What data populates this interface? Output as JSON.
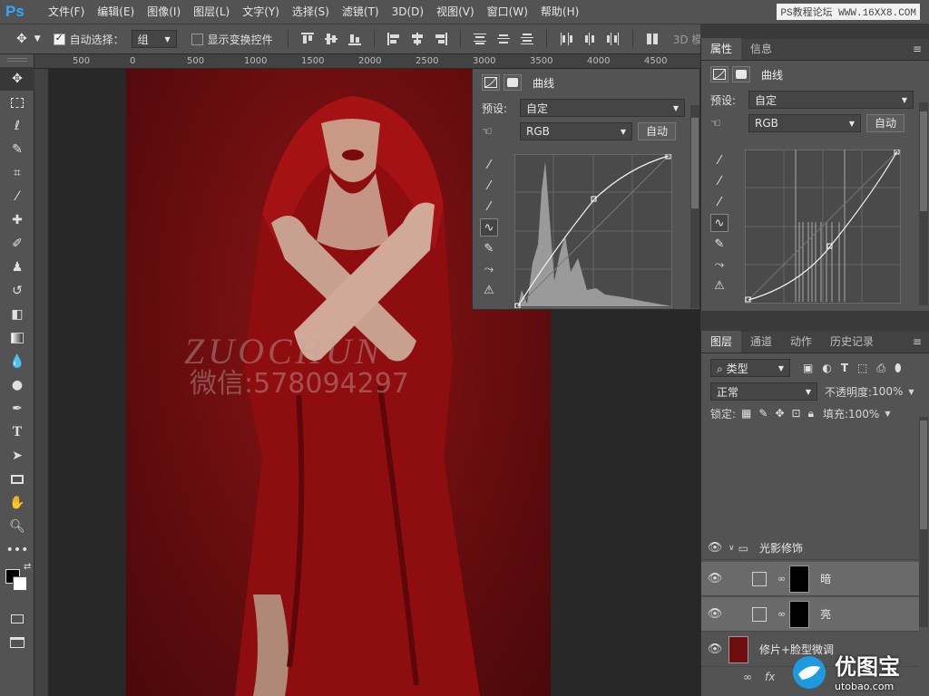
{
  "app": {
    "logo": "Ps",
    "watermark_top": "PS教程论坛 WWW.16XX8.COM"
  },
  "menu": [
    "文件(F)",
    "编辑(E)",
    "图像(I)",
    "图层(L)",
    "文字(Y)",
    "选择(S)",
    "滤镜(T)",
    "3D(D)",
    "视图(V)",
    "窗口(W)",
    "帮助(H)"
  ],
  "options": {
    "auto_select_label": "自动选择：",
    "auto_select_value": "组",
    "show_transform_label": "显示变换控件",
    "mode_3d": "3D 模"
  },
  "ruler": {
    "ticks": [
      "500",
      "0",
      "500",
      "1000",
      "1500",
      "2000",
      "2500",
      "3000",
      "3500",
      "4000",
      "4500"
    ]
  },
  "photo": {
    "watermark_line1": "ZUOCHUN",
    "watermark_line2": "微信:578094297"
  },
  "float_curves": {
    "title": "曲线",
    "preset_label": "预设:",
    "preset_value": "自定",
    "channel": "RGB",
    "auto_btn": "自动"
  },
  "properties": {
    "tabs": [
      "属性",
      "信息"
    ],
    "title": "曲线",
    "preset_label": "预设:",
    "preset_value": "自定",
    "channel": "RGB",
    "auto_btn": "自动"
  },
  "layers": {
    "tabs": [
      "图层",
      "通道",
      "动作",
      "历史记录"
    ],
    "filter_value": "类型",
    "blend_mode": "正常",
    "opacity_label": "不透明度:",
    "opacity_value": "100%",
    "lock_label": "锁定:",
    "fill_label": "填充:",
    "fill_value": "100%",
    "rows": [
      {
        "name": "光影修饰"
      },
      {
        "name": "暗"
      },
      {
        "name": "亮"
      },
      {
        "name": "修片+脸型微调"
      }
    ],
    "footer": {
      "fx": "fx"
    }
  },
  "corner_logo": {
    "name": "优图宝",
    "url": "utobao.com"
  },
  "colors": {
    "accent": "#31a8ff",
    "photo_red": "#7a0f12",
    "panel": "#535353"
  }
}
